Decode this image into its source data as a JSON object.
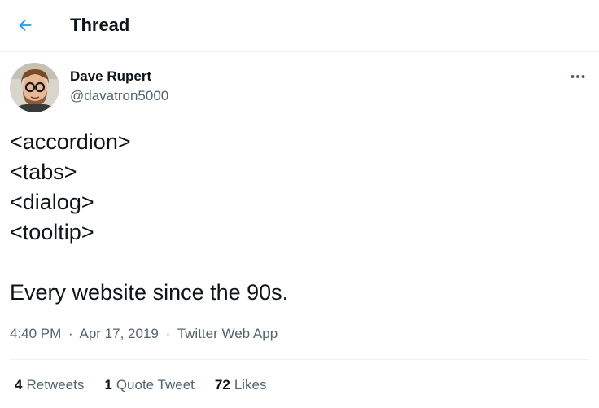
{
  "header": {
    "back_icon": "arrow-left-icon",
    "title": "Thread",
    "accent_color": "#1d9bf0"
  },
  "tweet": {
    "author": {
      "name": "Dave Rupert",
      "handle": "@davatron5000",
      "avatar_icon": "user-avatar"
    },
    "more_icon": "more-horizontal-icon",
    "lines": [
      "<accordion>",
      "<tabs>",
      "<dialog>",
      "<tooltip>",
      "",
      "Every website since the 90s."
    ],
    "time": "4:40 PM",
    "date": "Apr 17, 2019",
    "source": "Twitter Web App",
    "separator": "·",
    "stats": {
      "retweets_count": "4",
      "retweets_label": "Retweets",
      "quotes_count": "1",
      "quotes_label": "Quote Tweet",
      "likes_count": "72",
      "likes_label": "Likes"
    }
  }
}
